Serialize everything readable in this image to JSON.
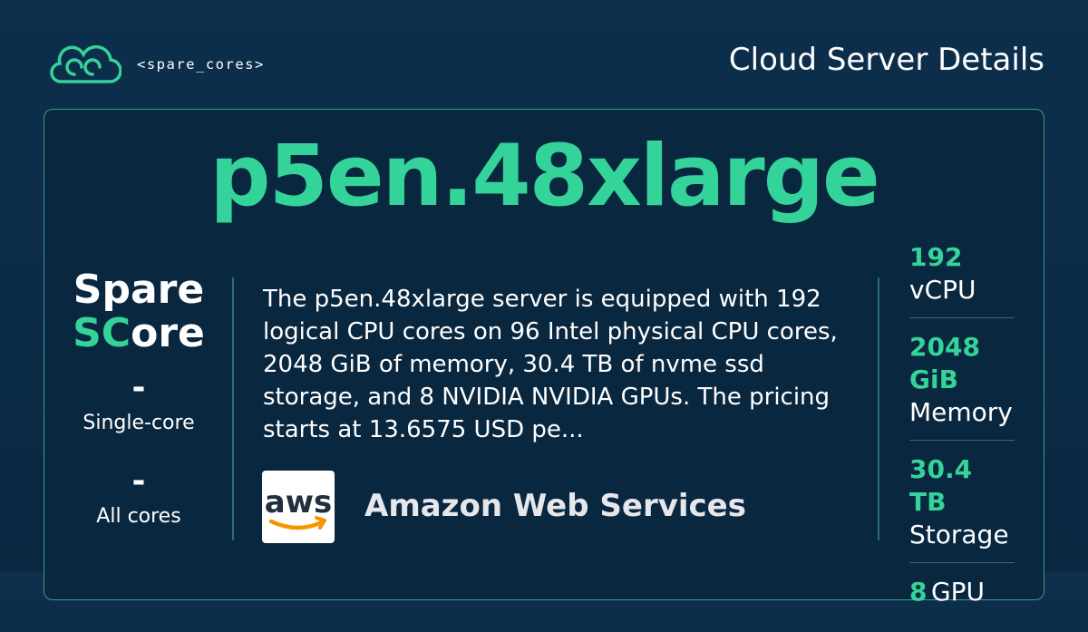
{
  "brand": {
    "logo_text": "<spare_cores>"
  },
  "header": {
    "title": "Cloud Server Details"
  },
  "server": {
    "name": "p5en.48xlarge"
  },
  "score": {
    "word1": "Spare",
    "word2_accent": "SC",
    "word2_rest": "ore",
    "single_core_value": "-",
    "single_core_label": "Single-core",
    "all_cores_value": "-",
    "all_cores_label": "All cores"
  },
  "description": "The p5en.48xlarge server is equipped with 192 logical CPU cores on 96 Intel physical CPU cores, 2048 GiB of memory, 30.4 TB of nvme ssd storage, and 8 NVIDIA NVIDIA GPUs. The pricing starts at 13.6575 USD pe...",
  "vendor": {
    "logo_text": "aws",
    "name": "Amazon Web Services"
  },
  "stats": {
    "vcpu_value": "192",
    "vcpu_label": "vCPU",
    "memory_value_1": "2048",
    "memory_value_2": "GiB",
    "memory_label": "Memory",
    "storage_value": "30.4 TB",
    "storage_label": "Storage",
    "gpu_value": "8",
    "gpu_label": "GPU"
  },
  "colors": {
    "accent": "#34d399",
    "background": "#0d2f4c",
    "card_border": "#3a9a86",
    "aws_orange": "#f79400",
    "aws_text": "#232f3e"
  },
  "icons": {
    "brand_logo": "spare-cores-cloud-icon",
    "vendor_logo": "aws-logo-icon"
  }
}
